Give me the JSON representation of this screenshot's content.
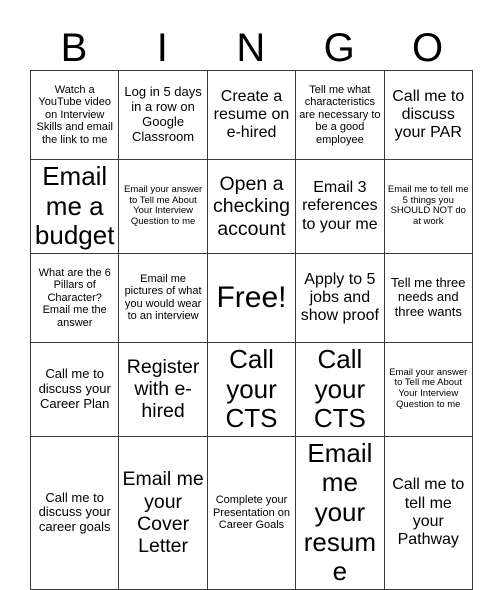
{
  "header": {
    "letters": [
      "B",
      "I",
      "N",
      "G",
      "O"
    ]
  },
  "grid": {
    "rows": [
      [
        {
          "text": "Watch a YouTube video on Interview Skills and email the link to me",
          "size": "fs-s"
        },
        {
          "text": "Log in 5 days in a row on Google Classroom",
          "size": "fs-m"
        },
        {
          "text": "Create a resume on e-hired",
          "size": "fs-l"
        },
        {
          "text": "Tell me what characteristics are necessary to be a good employee",
          "size": "fs-s"
        },
        {
          "text": "Call me to discuss your PAR",
          "size": "fs-l"
        }
      ],
      [
        {
          "text": "Email me a budget",
          "size": "fs-xxl"
        },
        {
          "text": "Email your answer to Tell me About Your Interview Question to me",
          "size": "fs-xs"
        },
        {
          "text": "Open a checking account",
          "size": "fs-xl"
        },
        {
          "text": "Email 3 references to your me",
          "size": "fs-l"
        },
        {
          "text": "Email me to tell me 5 things you SHOULD NOT do at work",
          "size": "fs-xs"
        }
      ],
      [
        {
          "text": "What are the 6 Pillars of Character? Email me the answer",
          "size": "fs-s"
        },
        {
          "text": "Email me pictures of what you would wear to an interview",
          "size": "fs-s"
        },
        {
          "text": "Free!",
          "size": "fs-free"
        },
        {
          "text": "Apply to 5 jobs and show proof",
          "size": "fs-l"
        },
        {
          "text": "Tell me three needs and three wants",
          "size": "fs-m"
        }
      ],
      [
        {
          "text": "Call me to discuss your Career Plan",
          "size": "fs-m"
        },
        {
          "text": "Register with e-hired",
          "size": "fs-xl"
        },
        {
          "text": "Call your CTS",
          "size": "fs-xxl"
        },
        {
          "text": "Call your CTS",
          "size": "fs-xxl"
        },
        {
          "text": "Email your answer to Tell me About Your Interview Question to me",
          "size": "fs-xs"
        }
      ],
      [
        {
          "text": "Call me to discuss your career goals",
          "size": "fs-m"
        },
        {
          "text": "Email me your Cover Letter",
          "size": "fs-xl"
        },
        {
          "text": "Complete your Presentation on Career Goals",
          "size": "fs-s"
        },
        {
          "text": "Email me your resume",
          "size": "fs-xxl"
        },
        {
          "text": "Call me to tell me your Pathway",
          "size": "fs-l"
        }
      ]
    ]
  }
}
